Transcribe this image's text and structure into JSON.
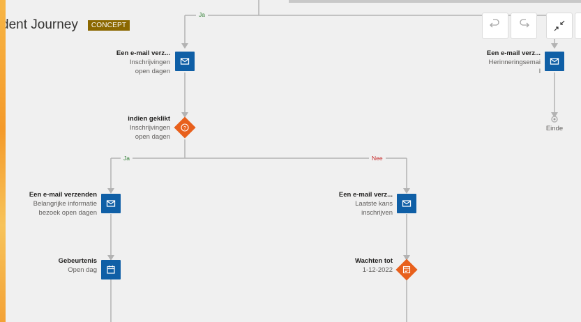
{
  "header": {
    "title": "dent Journey",
    "badge": "CONCEPT"
  },
  "toolbar": {
    "undo_icon": "undo-icon",
    "redo_icon": "redo-icon",
    "collapse_icon": "collapse-icon"
  },
  "branches": {
    "ja_top": "Ja",
    "ja_left": "Ja",
    "nee": "Nee"
  },
  "nodes": {
    "email_top": {
      "title": "Een e-mail verz...",
      "line1": "Inschrijvingen",
      "line2": "open dagen"
    },
    "email_right": {
      "title": "Een e-mail verz...",
      "line1": "Herinneringsemai",
      "line2": "l"
    },
    "end": {
      "label": "Einde"
    },
    "condition": {
      "title": "indien geklikt",
      "line1": "Inschrijvingen",
      "line2": "open dagen"
    },
    "email_left": {
      "title": "Een e-mail verzenden",
      "line1": "Belangrijke informatie",
      "line2": "bezoek open dagen"
    },
    "email_mid": {
      "title": "Een e-mail verz...",
      "line1": "Laatste kans",
      "line2": "inschrijven"
    },
    "event": {
      "title": "Gebeurtenis",
      "line1": "Open dag"
    },
    "wait": {
      "title": "Wachten tot",
      "line1": "1-12-2022"
    }
  },
  "colors": {
    "email_box": "#0f5fa6",
    "condition_diamond": "#e8601c",
    "ja": "#2e7d32",
    "nee": "#c62828",
    "badge": "#8b6800"
  }
}
